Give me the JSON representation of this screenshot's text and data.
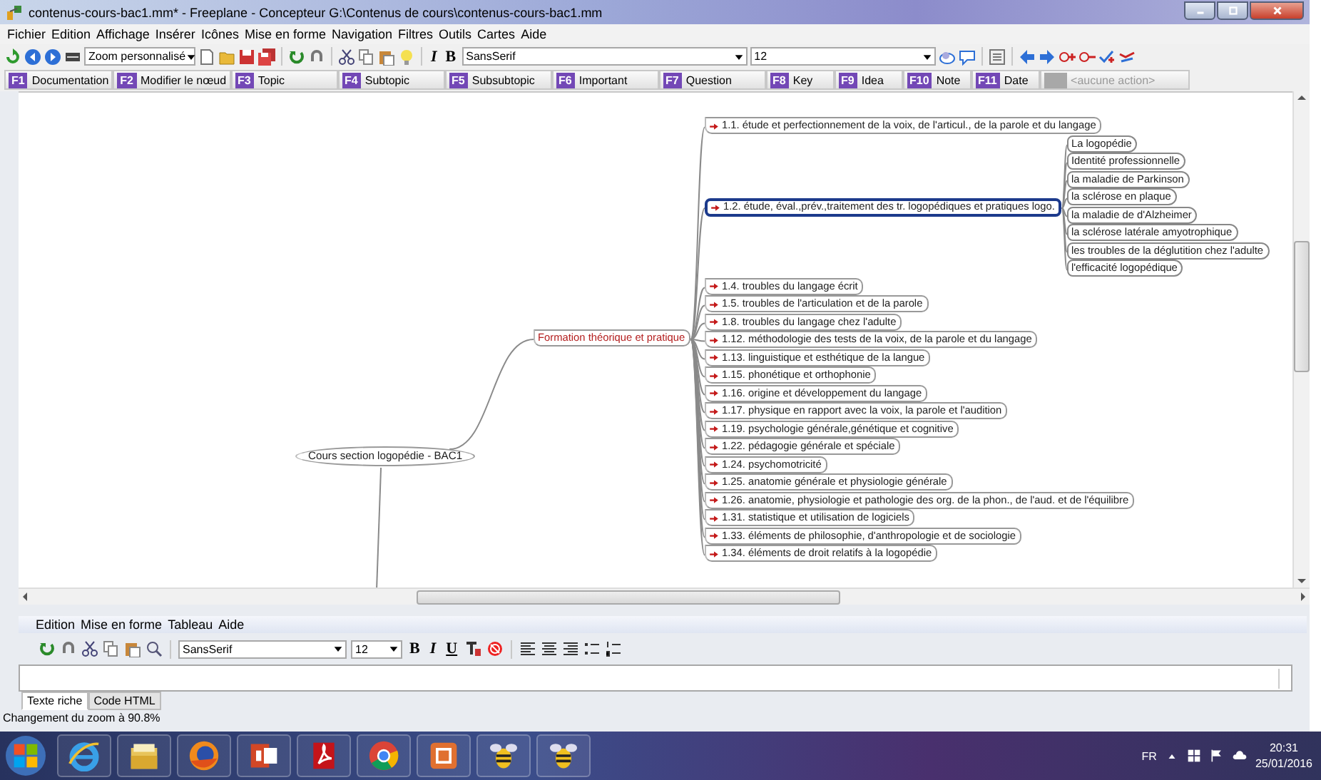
{
  "window": {
    "title": "contenus-cours-bac1.mm* - Freeplane - Concepteur G:\\Contenus de cours\\contenus-cours-bac1.mm"
  },
  "menu": [
    "Fichier",
    "Edition",
    "Affichage",
    "Insérer",
    "Icônes",
    "Mise en forme",
    "Navigation",
    "Filtres",
    "Outils",
    "Cartes",
    "Aide"
  ],
  "toolbar": {
    "zoom": "Zoom personnalisé",
    "format_buttons": [
      "I",
      "B"
    ],
    "font": "SansSerif",
    "size": "12"
  },
  "fkeys": [
    {
      "key": "F1",
      "label": "Documentation",
      "disabled": false
    },
    {
      "key": "F2",
      "label": "Modifier le nœud",
      "disabled": false
    },
    {
      "key": "F3",
      "label": "Topic",
      "disabled": false
    },
    {
      "key": "F4",
      "label": "Subtopic",
      "disabled": false
    },
    {
      "key": "F5",
      "label": "Subsubtopic",
      "disabled": false
    },
    {
      "key": "F6",
      "label": "Important",
      "disabled": false
    },
    {
      "key": "F7",
      "label": "Question",
      "disabled": false
    },
    {
      "key": "F8",
      "label": "Key",
      "disabled": false
    },
    {
      "key": "F9",
      "label": "Idea",
      "disabled": false
    },
    {
      "key": "F10",
      "label": "Note",
      "disabled": false
    },
    {
      "key": "F11",
      "label": "Date",
      "disabled": false
    },
    {
      "label": "<aucune action>",
      "disabled": true
    }
  ],
  "map": {
    "root": {
      "label": "Cours section logopédie - BAC1",
      "kind": "root",
      "selected": false,
      "children": [
        {
          "label": "Formation théorique et  pratique",
          "kind": "branch",
          "selected": false,
          "children": [
            {
              "label": "1.1. étude et perfectionnement de la voix, de l'articul., de la parole et du langage",
              "kind": "link",
              "selected": false
            },
            {
              "label": "1.2. étude, éval.,prév.,traitement des tr. logopédiques et pratiques logo.",
              "kind": "link",
              "selected": true,
              "children": [
                {
                  "label": "La logopédie",
                  "kind": "plain",
                  "selected": false
                },
                {
                  "label": "Identité professionnelle",
                  "kind": "plain",
                  "selected": false
                },
                {
                  "label": "la maladie de Parkinson",
                  "kind": "plain",
                  "selected": false
                },
                {
                  "label": "la sclérose en plaque",
                  "kind": "plain",
                  "selected": false
                },
                {
                  "label": "la maladie de d'Alzheimer",
                  "kind": "plain",
                  "selected": false
                },
                {
                  "label": "la sclérose latérale amyotrophique",
                  "kind": "plain",
                  "selected": false
                },
                {
                  "label": "les troubles de la déglutition chez l'adulte",
                  "kind": "plain",
                  "selected": false
                },
                {
                  "label": "l'efficacité logopédique",
                  "kind": "plain",
                  "selected": false
                }
              ]
            },
            {
              "label": "1.4. troubles du langage écrit",
              "kind": "link",
              "selected": false
            },
            {
              "label": "1.5. troubles de l'articulation et de la parole",
              "kind": "link",
              "selected": false
            },
            {
              "label": "1.8. troubles du langage chez l'adulte",
              "kind": "link",
              "selected": false
            },
            {
              "label": "1.12. méthodologie des tests de la voix, de la parole et du langage",
              "kind": "link",
              "selected": false
            },
            {
              "label": "1.13. linguistique et esthétique de la langue",
              "kind": "link",
              "selected": false
            },
            {
              "label": "1.15. phonétique et orthophonie",
              "kind": "link",
              "selected": false
            },
            {
              "label": "1.16. origine et développement du langage",
              "kind": "link",
              "selected": false
            },
            {
              "label": "1.17. physique en rapport avec la voix, la parole et l'audition",
              "kind": "link",
              "selected": false
            },
            {
              "label": "1.19. psychologie générale,génétique et cognitive",
              "kind": "link",
              "selected": false
            },
            {
              "label": "1.22. pédagogie générale et spéciale",
              "kind": "link",
              "selected": false
            },
            {
              "label": "1.24. psychomotricité",
              "kind": "link",
              "selected": false
            },
            {
              "label": "1.25. anatomie générale et physiologie générale",
              "kind": "link",
              "selected": false
            },
            {
              "label": "1.26. anatomie, physiologie et pathologie des org. de la phon., de l'aud. et de l'équilibre",
              "kind": "link",
              "selected": false
            },
            {
              "label": "1.31. statistique et utilisation de logiciels",
              "kind": "link",
              "selected": false
            },
            {
              "label": "1.33. éléments de philosophie, d'anthropologie et de sociologie",
              "kind": "link",
              "selected": false
            },
            {
              "label": "1.34. éléments de droit relatifs à la logopédie",
              "kind": "link",
              "selected": false
            }
          ]
        }
      ]
    }
  },
  "editor": {
    "menu": [
      "Edition",
      "Mise en forme",
      "Tableau",
      "Aide"
    ],
    "font": "SansSerif",
    "size": "12",
    "format_buttons": [
      "B",
      "I",
      "U"
    ],
    "tabs": [
      {
        "label": "Texte riche",
        "selected": true
      },
      {
        "label": "Code HTML",
        "selected": false
      }
    ]
  },
  "status_bar": "Changement du zoom à 90.8%",
  "taskbar": {
    "language": "FR",
    "time": "20:31",
    "date": "25/01/2016"
  }
}
